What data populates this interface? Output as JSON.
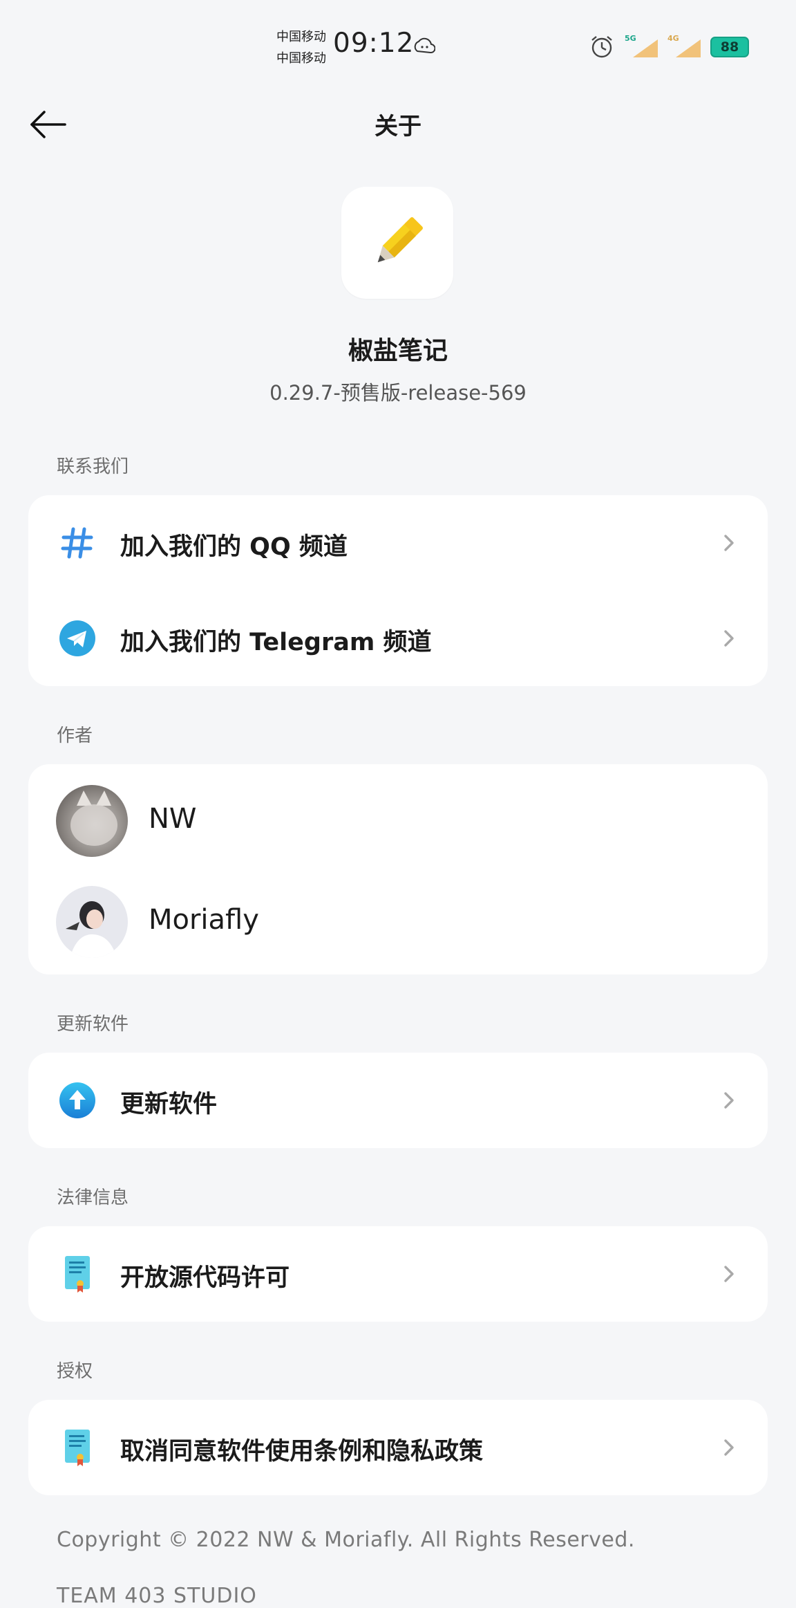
{
  "status_bar": {
    "carrier_1": "中国移动",
    "carrier_2": "中国移动",
    "time": "09:12",
    "net_1": "5G",
    "net_2": "4G",
    "battery": "88",
    "battery_color": "#1bc0a0"
  },
  "header": {
    "title": "关于",
    "back_icon": "arrow-left-icon"
  },
  "app": {
    "name": "椒盐笔记",
    "version": "0.29.7-预售版-release-569",
    "icon": "pencil-icon"
  },
  "sections": {
    "contact": {
      "label": "联系我们",
      "items": [
        {
          "label": "加入我们的 QQ 频道",
          "icon": "hashtag-icon"
        },
        {
          "label": "加入我们的 Telegram 频道",
          "icon": "telegram-icon"
        }
      ]
    },
    "authors": {
      "label": "作者",
      "items": [
        {
          "name": "NW",
          "icon": "avatar-cat"
        },
        {
          "name": "Moriafly",
          "icon": "avatar-girl"
        }
      ]
    },
    "update": {
      "label": "更新软件",
      "items": [
        {
          "label": "更新软件",
          "icon": "upload-arrow-icon"
        }
      ]
    },
    "legal": {
      "label": "法律信息",
      "items": [
        {
          "label": "开放源代码许可",
          "icon": "document-icon"
        }
      ]
    },
    "auth": {
      "label": "授权",
      "items": [
        {
          "label": "取消同意软件使用条例和隐私政策",
          "icon": "document-icon"
        }
      ]
    }
  },
  "footer": {
    "copyright": "Copyright © 2022 NW & Moriafly. All Rights Reserved.",
    "team": "TEAM 403 STUDIO"
  },
  "colors": {
    "accent_blue": "#2b8de0",
    "background": "#f5f6f8",
    "card": "#ffffff"
  }
}
